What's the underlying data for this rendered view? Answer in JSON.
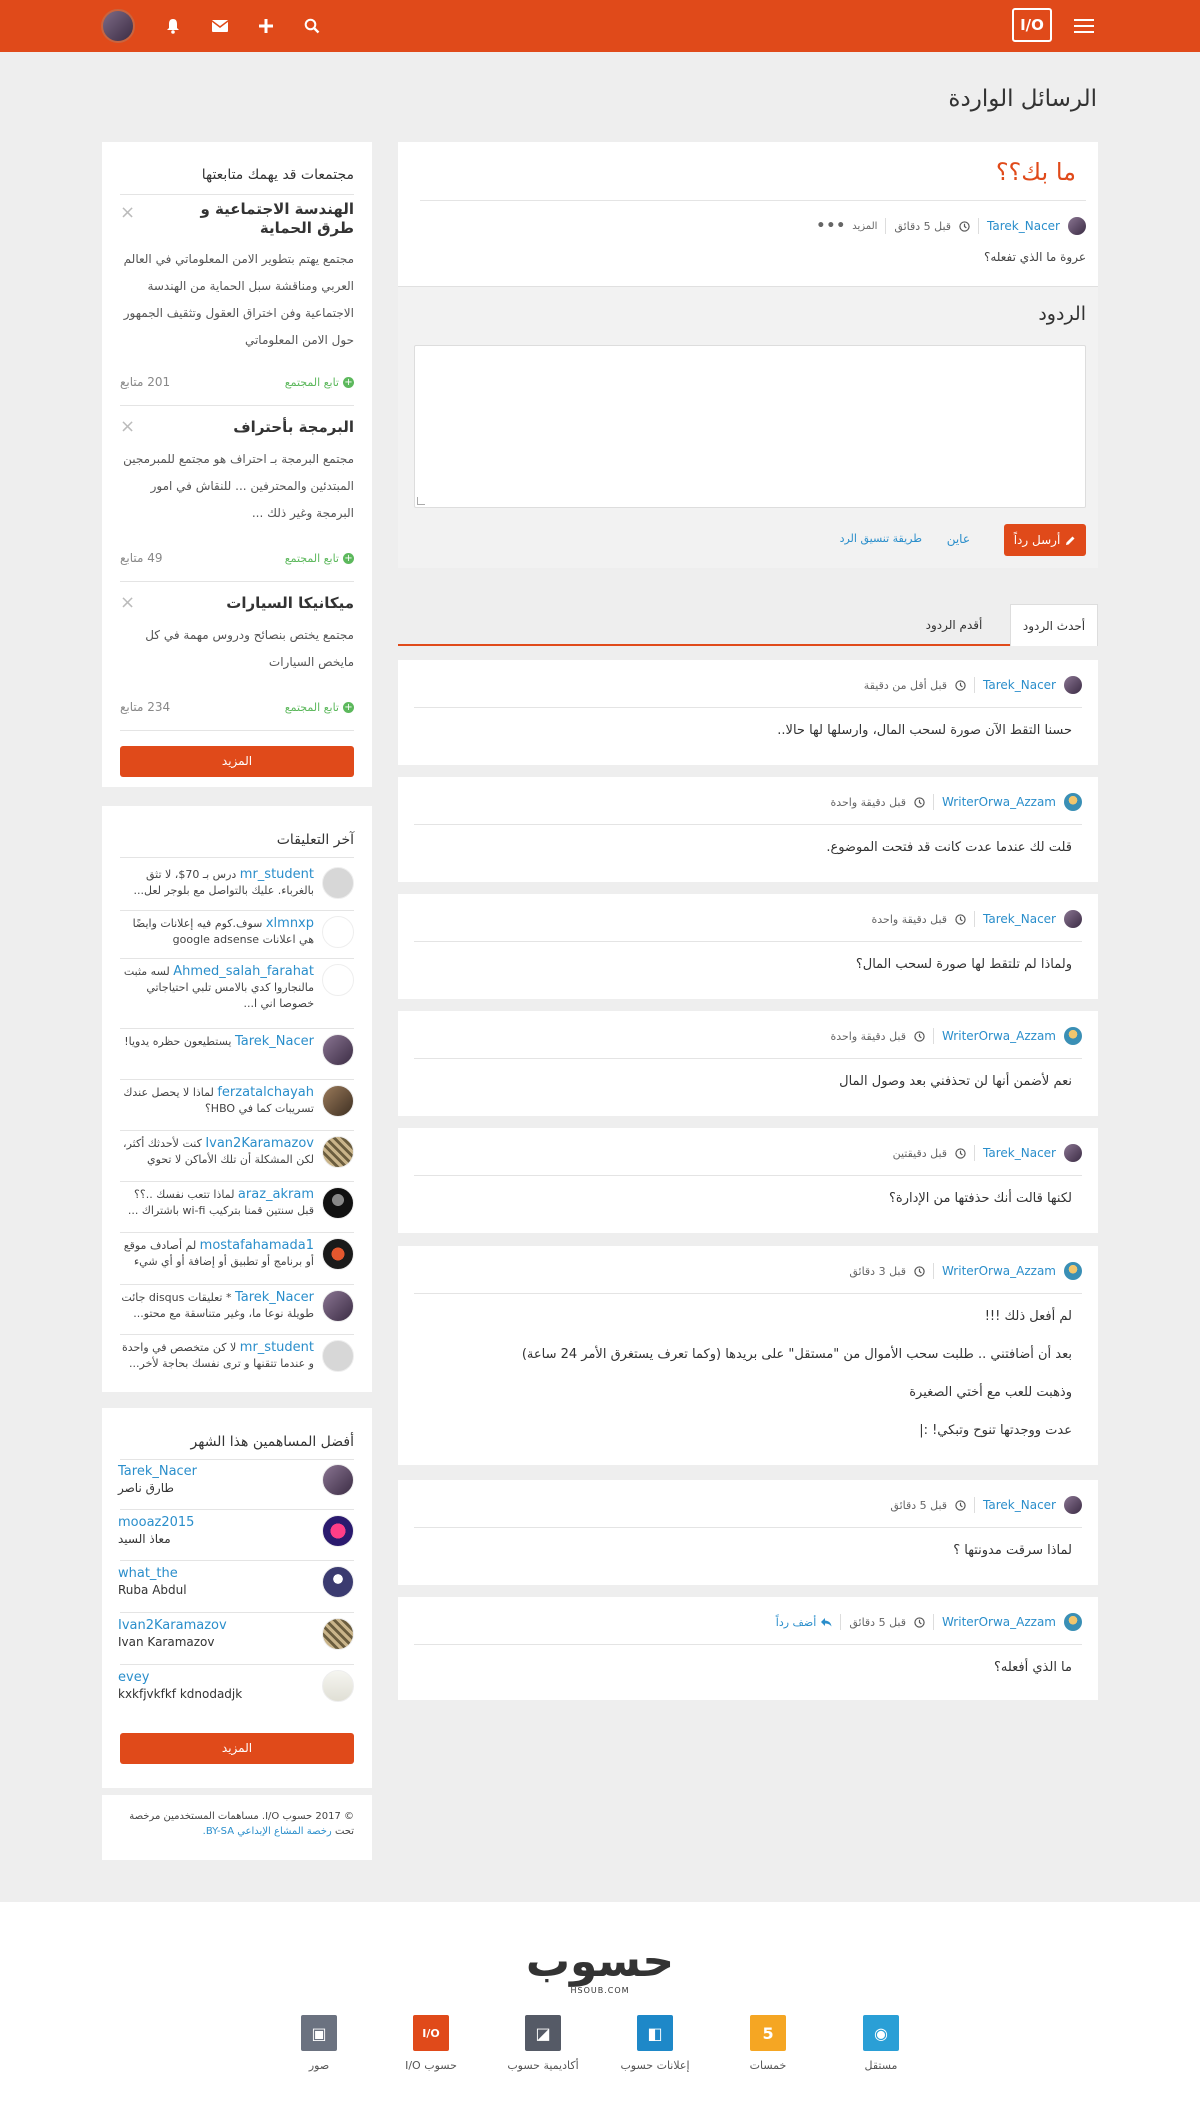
{
  "nav": {
    "logo": "I/O",
    "menu_icon": "menu-icon",
    "search_icon": "search-icon",
    "plus_icon": "plus-icon",
    "mail_icon": "mail-icon",
    "bell_icon": "bell-icon"
  },
  "page": {
    "title": "الرسائل الواردة"
  },
  "post": {
    "title": "ما بك؟؟",
    "author": "Tarek_Nacer",
    "time": "قبل 5 دقائق",
    "more_label": "المزيد",
    "body": "عروة ما الذي تفعله؟"
  },
  "reply_form": {
    "heading": "الردود",
    "submit_label": "أرسل رداً",
    "preview_label": "عاين",
    "format_label": "طريقة تنسيق الرد"
  },
  "tabs": {
    "newest": "أحدث الردود",
    "oldest": "أقدم الردود"
  },
  "replies": [
    {
      "author": "Tarek_Nacer",
      "time": "قبل أقل من دقيقة",
      "lines": [
        "حسنا التقط الآن صورة لسحب المال، وارسلها لها حالا.."
      ]
    },
    {
      "author": "WriterOrwa_Azzam",
      "time": "قبل دقيقة واحدة",
      "lines": [
        "قلت لك عندما عدت كانت قد فتحت الموضوع."
      ]
    },
    {
      "author": "Tarek_Nacer",
      "time": "قبل دقيقة واحدة",
      "lines": [
        "ولماذا لم تلتقط لها صورة لسحب المال؟"
      ]
    },
    {
      "author": "WriterOrwa_Azzam",
      "time": "قبل دقيقة واحدة",
      "lines": [
        "نعم لأضمن أنها لن تحذفني بعد وصول المال"
      ]
    },
    {
      "author": "Tarek_Nacer",
      "time": "قبل دقيقتين",
      "lines": [
        "لكنها قالت أنك حذفتها من الإدارة؟"
      ]
    },
    {
      "author": "WriterOrwa_Azzam",
      "time": "قبل 3 دقائق",
      "lines": [
        "لم أفعل ذلك !!!",
        "بعد أن أضافتني .. طلبت سحب الأموال من \"مستقل\" على بريدها (وكما تعرف يستغرق الأمر 24 ساعة)",
        "وذهبت للعب مع أختي الصغيرة",
        "عدت ووجدتها تنوح وتبكي! :|"
      ]
    },
    {
      "author": "Tarek_Nacer",
      "time": "قبل 5 دقائق",
      "lines": [
        "لماذا سرقت مدونتها ؟"
      ]
    },
    {
      "author": "WriterOrwa_Azzam",
      "time": "قبل 5 دقائق",
      "reply_action": "أضف رداً",
      "lines": [
        "ما الذي أفعله؟"
      ]
    }
  ],
  "sidebar": {
    "communities": {
      "title": "مجتمعات قد يهمك متابعتها",
      "items": [
        {
          "name": "الهندسة الاجتماعية و طرق الحماية",
          "desc": "مجتمع يهتم بتطوير الامن المعلوماتي في العالم العربي ومناقشة سبل الحماية من الهندسة الاجتماعية وفن اختراق العقول وتثقيف الجمهور حول الامن المعلوماتي",
          "follow": "تابع المجتمع",
          "followers": "201 متابع"
        },
        {
          "name": "البرمجة بأحتراف",
          "desc": "مجتمع البرمجة بـ احتراف هو مجتمع للمبرمجين المبتدئين والمحترفين ... للنقاش في امور البرمجة وغير ذلك ...",
          "follow": "تابع المجتمع",
          "followers": "49 متابع"
        },
        {
          "name": "ميكانيكا السيارات",
          "desc": "مجتمع يختص بنصائح ودروس مهمة في كل مايخص السيارات",
          "follow": "تابع المجتمع",
          "followers": "234 متابع"
        }
      ],
      "more_label": "المزيد"
    },
    "comments": {
      "title": "آخر التعليقات",
      "items": [
        {
          "user": "mr_student",
          "text": "درس بـ 70$، لا تثق بالغرباء. عليك بالتواصل مع بلوجر لعل..."
        },
        {
          "user": "xlmnxp",
          "text": "سوف.كوم فيه إعلانات وايضًا هي اعلانات google adsense"
        },
        {
          "user": "Ahmed_salah_farahat",
          "text": "لسه مثبت مالنجاروا كدي بالامس تلبي احتياجاتي خصوصا اني ا..."
        },
        {
          "user": "Tarek_Nacer",
          "text": "يستطيعون حظره يدويا!"
        },
        {
          "user": "ferzatalchayah",
          "text": "لماذا لا يحصل عندك تسريبات كما في HBO؟"
        },
        {
          "user": "Ivan2Karamazov",
          "text": "كنت لأحدثك أكثر، لكن المشكلة أن تلك الأماكن لا تحوي إنتر..."
        },
        {
          "user": "araz_akram",
          "text": "لماذا تتعب نفسك ..؟؟ قبل سنتين قمنا بتركيب wi-fi باشتراك ..."
        },
        {
          "user": "mostafahamada1",
          "text": "لم أصادف موقع أو برنامج أو تطبيق أو إضافة أو أي شيء إلى ع..."
        },
        {
          "user": "Tarek_Nacer",
          "text": "* تعليقات disqus جائت طويلة نوعا ما، وغير متناسقة مع محتو..."
        },
        {
          "user": "mr_student",
          "text": "لا كن متخصص في واحدة و عندما تتقنها و ترى نفسك بحاجة لأخر..."
        }
      ]
    },
    "contributors": {
      "title": "أفضل المساهمين هذا الشهر",
      "items": [
        {
          "user": "Tarek_Nacer",
          "name": "طارق ناصر"
        },
        {
          "user": "mooaz2015",
          "name": "معاذ السيد"
        },
        {
          "user": "what_the",
          "name": "Ruba Abdul"
        },
        {
          "user": "Ivan2Karamazov",
          "name": "Ivan Karamazov"
        },
        {
          "user": "evey",
          "name": "kxkfjvkfkf kdnodadjk"
        }
      ],
      "more_label": "المزيد"
    },
    "copyright": {
      "text": "© 2017 حسوب I/O. مساهمات المستخدمين مرخصة تحت",
      "license": "رخصة المشاع الإبداعي BY-SA."
    }
  },
  "footer": {
    "logo": "حسوب",
    "logo_sub": "HSOUB.COM",
    "links": [
      {
        "label": "مستقل",
        "color": "#2a9fd6"
      },
      {
        "label": "خمسات",
        "color": "#f5a623"
      },
      {
        "label": "إعلانات حسوب",
        "color": "#1e88c8"
      },
      {
        "label": "أكاديمية حسوب",
        "color": "#555a66"
      },
      {
        "label": "حسوب I/O",
        "color": "#e04a1a"
      },
      {
        "label": "صور",
        "color": "#6b7280"
      }
    ]
  },
  "colors": {
    "accent": "#e04a1a",
    "link": "#2a8ecb",
    "follow": "#5cb85c"
  }
}
